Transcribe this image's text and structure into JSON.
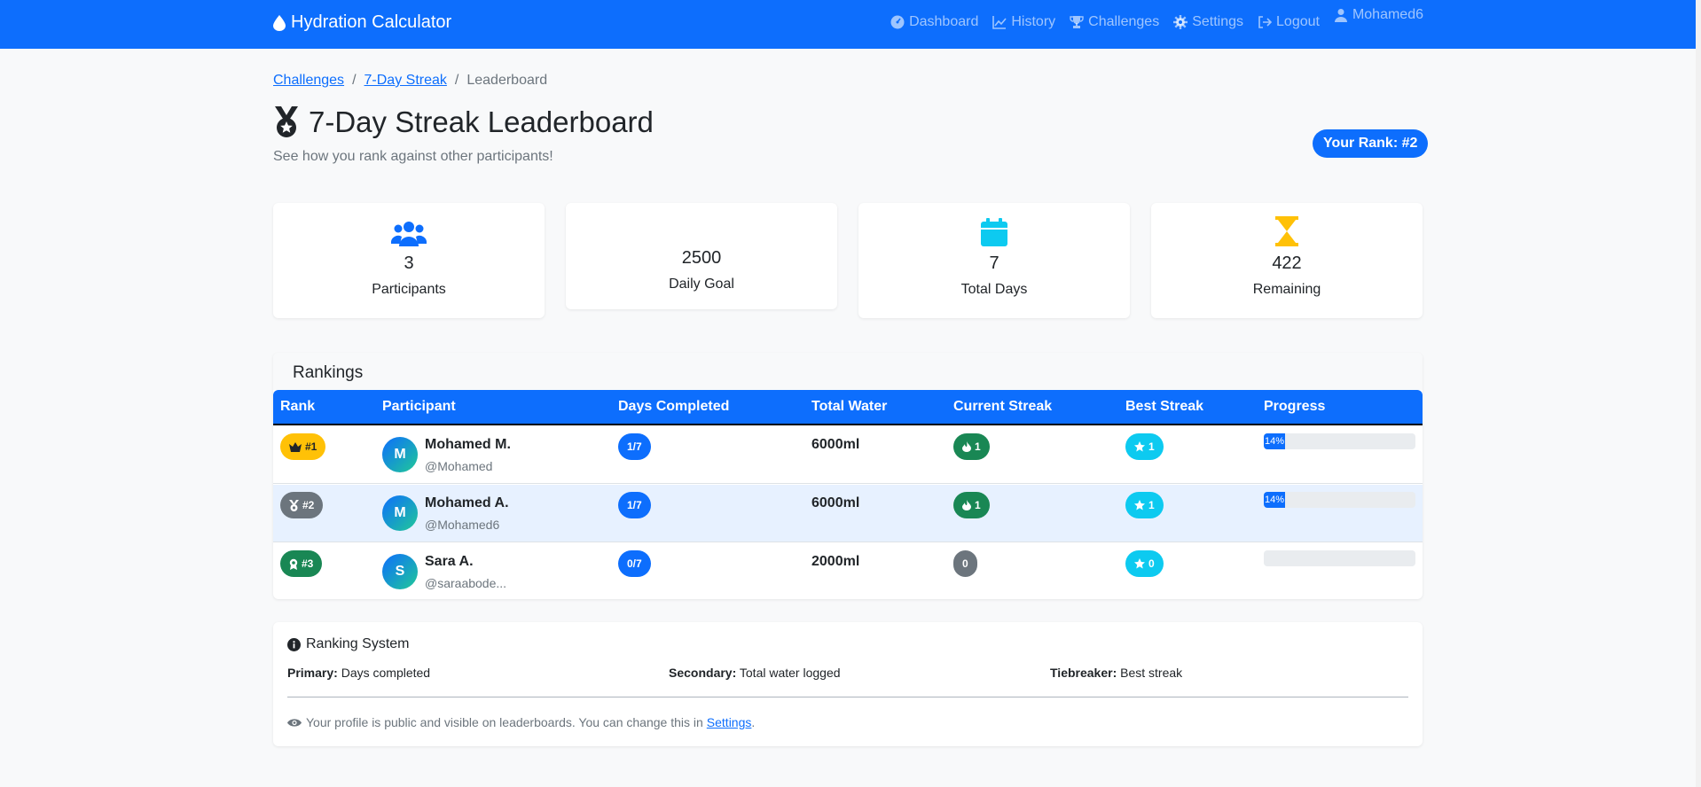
{
  "nav": {
    "brand": "Hydration Calculator",
    "links": [
      {
        "label": "Dashboard",
        "icon": "gauge-icon"
      },
      {
        "label": "History",
        "icon": "chart-line-icon"
      },
      {
        "label": "Challenges",
        "icon": "trophy-icon"
      },
      {
        "label": "Settings",
        "icon": "gear-icon"
      },
      {
        "label": "Logout",
        "icon": "logout-icon"
      }
    ],
    "user": "Mohamed6"
  },
  "breadcrumb": {
    "items": [
      "Challenges",
      "7-Day Streak",
      "Leaderboard"
    ],
    "sep": "/"
  },
  "page": {
    "title": "7-Day Streak Leaderboard",
    "subtitle": "See how you rank against other participants!",
    "your_rank": "Your Rank: #2"
  },
  "stats": [
    {
      "value": "3",
      "label": "Participants",
      "icon": "users-icon",
      "color": "#0d6efd"
    },
    {
      "value": "2500",
      "label": "Daily Goal",
      "icon": "",
      "color": ""
    },
    {
      "value": "7",
      "label": "Total Days",
      "icon": "calendar-icon",
      "color": "#0dcaf0"
    },
    {
      "value": "422",
      "label": "Remaining",
      "icon": "hourglass-icon",
      "color": "#ffc107"
    }
  ],
  "rankings": {
    "title": "Rankings",
    "columns": [
      "Rank",
      "Participant",
      "Days Completed",
      "Total Water",
      "Current Streak",
      "Best Streak",
      "Progress"
    ],
    "rows": [
      {
        "rank": "#1",
        "rank_color": "#ffc107",
        "rank_text_color": "#212529",
        "rank_icon": "crown-icon",
        "initial": "M",
        "name": "Mohamed M.",
        "user": "@Mohamed",
        "days": "1/7",
        "water": "6000ml",
        "streak": "1",
        "streak_color": "#198754",
        "best": "1",
        "progress": 14,
        "progress_label": "14%",
        "highlight": false
      },
      {
        "rank": "#2",
        "rank_color": "#6c757d",
        "rank_text_color": "#ffffff",
        "rank_icon": "medal-icon",
        "initial": "M",
        "name": "Mohamed A.",
        "user": "@Mohamed6",
        "days": "1/7",
        "water": "6000ml",
        "streak": "1",
        "streak_color": "#198754",
        "best": "1",
        "progress": 14,
        "progress_label": "14%",
        "highlight": true
      },
      {
        "rank": "#3",
        "rank_color": "#198754",
        "rank_text_color": "#ffffff",
        "rank_icon": "award-icon",
        "initial": "S",
        "name": "Sara A.",
        "user": "@saraabode...",
        "days": "0/7",
        "water": "2000ml",
        "streak": "0",
        "streak_color": "#6c757d",
        "best": "0",
        "progress": 0,
        "progress_label": "",
        "highlight": false
      }
    ]
  },
  "ranking_system": {
    "title": "Ranking System",
    "primary_label": "Primary:",
    "primary_value": "Days completed",
    "secondary_label": "Secondary:",
    "secondary_value": "Total water logged",
    "tiebreaker_label": "Tiebreaker:",
    "tiebreaker_value": "Best streak",
    "note": "Your profile is public and visible on leaderboards. You can change this in",
    "note_link": "Settings",
    "note_end": "."
  }
}
